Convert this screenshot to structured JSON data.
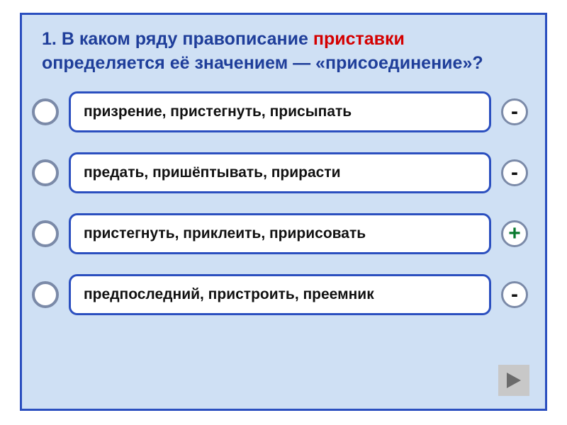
{
  "question": {
    "number": "1.",
    "part1": "В каком ряду правописание",
    "highlight": "приставки",
    "part2": "определяется её значением — «присоединение»?"
  },
  "options": [
    {
      "text": "призрение, пристегнуть, присыпать",
      "mark": "-",
      "correct": false
    },
    {
      "text": "предать, пришёптывать, прирасти",
      "mark": "-",
      "correct": false
    },
    {
      "text": "пристегнуть, приклеить, пририсовать",
      "mark": "+",
      "correct": true
    },
    {
      "text": "предпоследний, пристроить, преемник",
      "mark": "-",
      "correct": false
    }
  ],
  "nav": {
    "next_label": "next"
  }
}
